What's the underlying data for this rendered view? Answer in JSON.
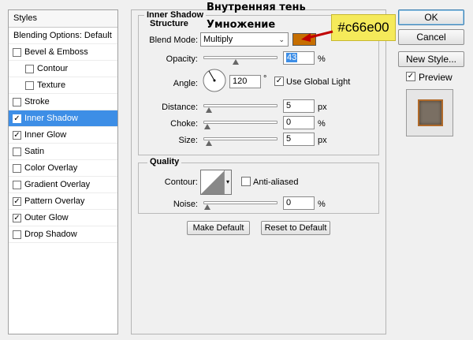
{
  "styles_panel": {
    "header": "Styles",
    "items": [
      {
        "label": "Blending Options: Default",
        "type": "plain"
      },
      {
        "label": "Bevel & Emboss",
        "checked": false
      },
      {
        "label": "Contour",
        "checked": false,
        "indent": true
      },
      {
        "label": "Texture",
        "checked": false,
        "indent": true
      },
      {
        "label": "Stroke",
        "checked": false
      },
      {
        "label": "Inner Shadow",
        "checked": true,
        "active": true
      },
      {
        "label": "Inner Glow",
        "checked": true
      },
      {
        "label": "Satin",
        "checked": false
      },
      {
        "label": "Color Overlay",
        "checked": false
      },
      {
        "label": "Gradient Overlay",
        "checked": false
      },
      {
        "label": "Pattern Overlay",
        "checked": true
      },
      {
        "label": "Outer Glow",
        "checked": true
      },
      {
        "label": "Drop Shadow",
        "checked": false
      }
    ]
  },
  "inner_shadow": {
    "title": "Inner Shadow",
    "structure": {
      "title": "Structure",
      "blend_mode_label": "Blend Mode:",
      "blend_mode_value": "Multiply",
      "color": "#c66e00",
      "opacity_label": "Opacity:",
      "opacity_value": "43",
      "opacity_unit": "%",
      "opacity_fraction": 0.43,
      "angle_label": "Angle:",
      "angle_value": "120",
      "angle_unit": "°",
      "use_global_light_label": "Use Global Light",
      "use_global_light_checked": true,
      "distance_label": "Distance:",
      "distance_value": "5",
      "distance_unit": "px",
      "distance_fraction": 0.02,
      "choke_label": "Choke:",
      "choke_value": "0",
      "choke_unit": "%",
      "choke_fraction": 0,
      "size_label": "Size:",
      "size_value": "5",
      "size_unit": "px",
      "size_fraction": 0.02
    },
    "quality": {
      "title": "Quality",
      "contour_label": "Contour:",
      "anti_aliased_label": "Anti-aliased",
      "anti_aliased_checked": false,
      "noise_label": "Noise:",
      "noise_value": "0",
      "noise_unit": "%",
      "noise_fraction": 0
    },
    "make_default_label": "Make Default",
    "reset_default_label": "Reset to Default"
  },
  "right": {
    "ok_label": "OK",
    "cancel_label": "Cancel",
    "new_style_label": "New Style...",
    "preview_label": "Preview",
    "preview_checked": true
  },
  "annotations": {
    "title_ru": "Внутренняя тень",
    "blend_ru": "Умножение",
    "color_callout": "#c66e00",
    "arrow_color": "#c00000"
  }
}
